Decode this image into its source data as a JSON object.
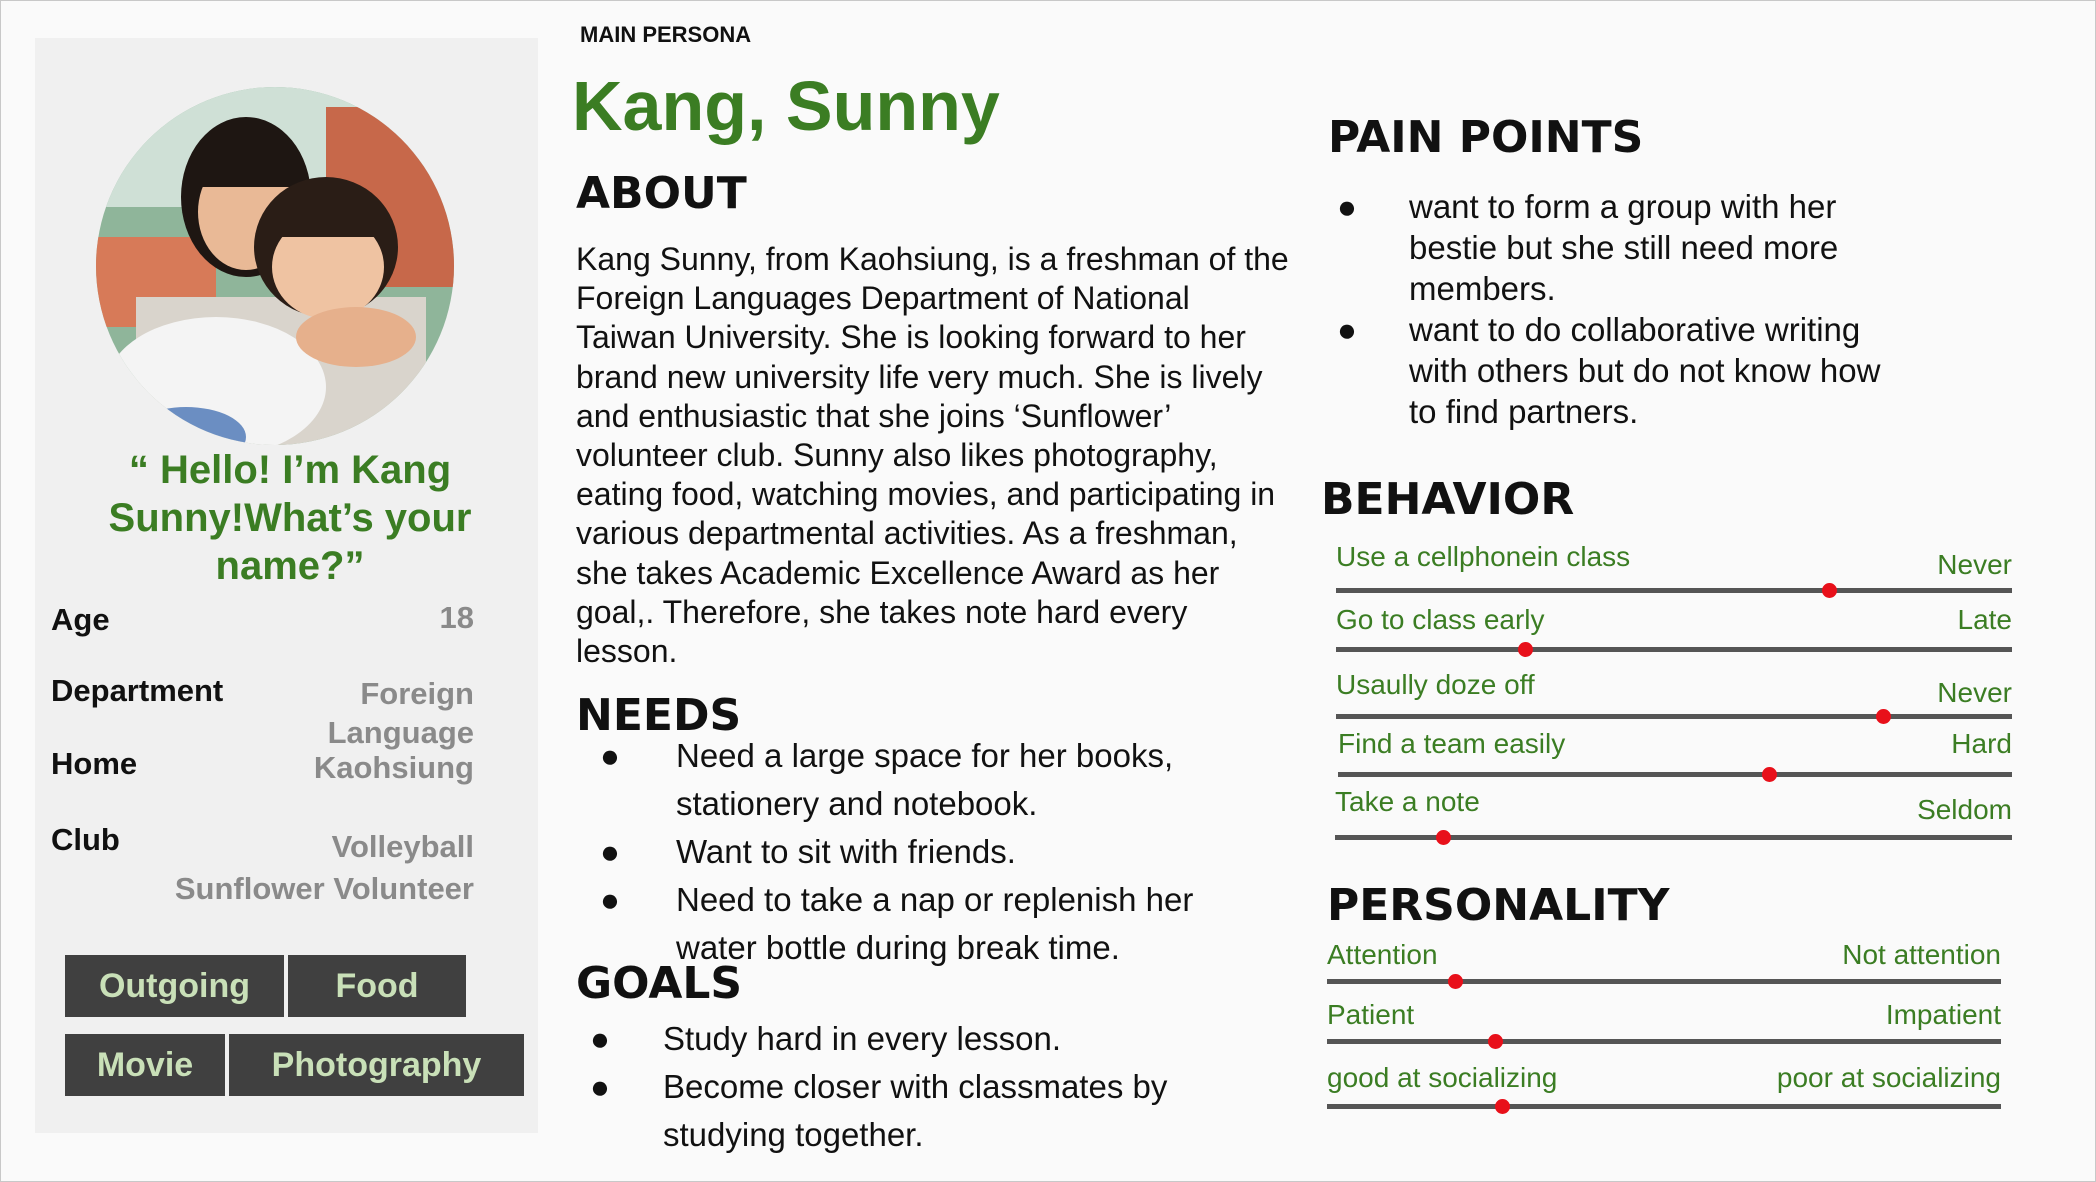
{
  "header": {
    "label": "MAIN PERSONA",
    "name": "Kang, Sunny"
  },
  "profile": {
    "quote": "“ Hello! I’m Kang Sunny!What’s your name?”",
    "rows": [
      {
        "label": "Age",
        "value": "18"
      },
      {
        "label": "Department",
        "value_lines": [
          "Foreign",
          "Language"
        ]
      },
      {
        "label": "Home",
        "value": "Kaohsiung"
      },
      {
        "label": "Club",
        "value_lines": [
          "Volleyball",
          "Sunflower Volunteer"
        ]
      }
    ],
    "tags": [
      "Outgoing",
      "Food",
      "Movie",
      "Photography"
    ]
  },
  "about": {
    "title": "ABOUT",
    "text": "Kang Sunny, from Kaohsiung, is a freshman of the Foreign Languages Department of National Taiwan  University. She is looking forward to her brand new university life very much. She is lively and enthusiastic  that she joins ‘Sunflower’ volunteer club. Sunny also likes photography, eating food, watching movies, and participating in various departmental activities. As a freshman, she takes Academic Excellence Award as her goal,. Therefore, she takes note hard every lesson."
  },
  "needs": {
    "title": "NEEDS",
    "items": [
      "Need a large space for her books, stationery and notebook.",
      "Want to sit with friends.",
      "Need to take a nap or replenish her water bottle during break time."
    ]
  },
  "goals": {
    "title": "GOALS",
    "items": [
      "Study hard in every lesson.",
      "Become closer with classmates by studying together."
    ]
  },
  "pain_points": {
    "title": "PAIN POINTS",
    "items": [
      "want to form a group with her bestie but she still need more members.",
      "want to do collaborative writing with others but do not know how to find partners."
    ]
  },
  "behavior": {
    "title": "BEHAVIOR",
    "scales": [
      {
        "left": "Use a cellphonein class",
        "right": "Never",
        "value": 0.73
      },
      {
        "left": "Go to class early",
        "right": "Late",
        "value": 0.28
      },
      {
        "left": "Usaully doze off",
        "right": "Never",
        "value": 0.81
      },
      {
        "left": "Find a team easily",
        "right": "Hard",
        "value": 0.64
      },
      {
        "left": "Take  a note",
        "right": "Seldom",
        "value": 0.16
      }
    ]
  },
  "personality": {
    "title": "PERSONALITY",
    "scales": [
      {
        "left": "Attention",
        "right": "Not attention",
        "value": 0.19
      },
      {
        "left": "Patient",
        "right": "Impatient",
        "value": 0.25
      },
      {
        "left": "good at socializing",
        "right": "poor at socializing",
        "value": 0.26
      }
    ]
  },
  "colors": {
    "accent_green": "#3b7d23",
    "tag_bg": "#404040",
    "slider_knob": "#e8101a"
  }
}
